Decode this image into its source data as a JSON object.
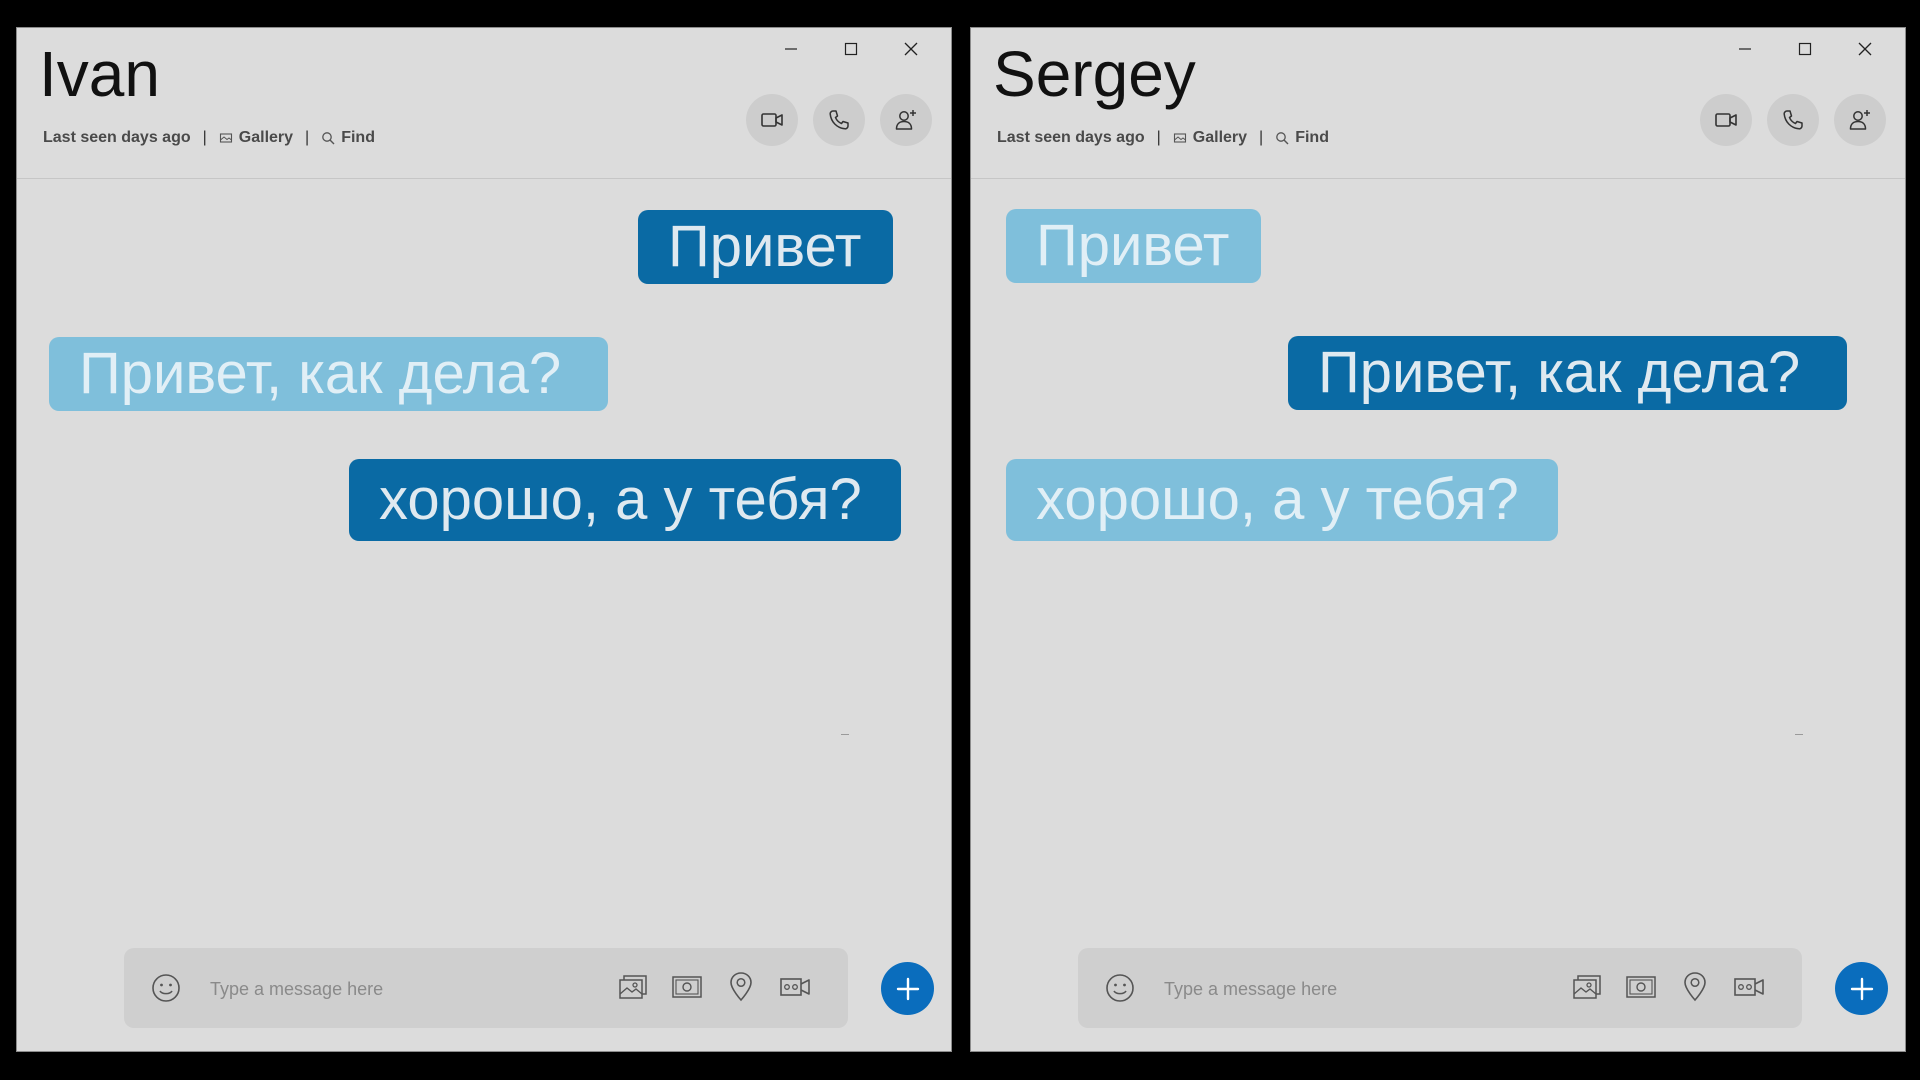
{
  "colors": {
    "sent_bubble": "#0a6aa4",
    "received_bubble": "#7fbfdb",
    "window_bg": "#dcdcdc",
    "fab": "#0a6dbd"
  },
  "left": {
    "contact_name": "Ivan",
    "status": "Last seen days ago",
    "gallery_label": "Gallery",
    "find_label": "Find",
    "composer_placeholder": "Type a message here",
    "messages": [
      {
        "text": "Привет",
        "direction": "sent"
      },
      {
        "text": "Привет, как дела?",
        "direction": "received"
      },
      {
        "text": "хорошо, а у тебя?",
        "direction": "sent"
      }
    ]
  },
  "right": {
    "contact_name": "Sergey",
    "status": "Last seen days ago",
    "gallery_label": "Gallery",
    "find_label": "Find",
    "composer_placeholder": "Type a message here",
    "messages": [
      {
        "text": "Привет",
        "direction": "received"
      },
      {
        "text": "Привет, как дела?",
        "direction": "sent"
      },
      {
        "text": "хорошо, а у тебя?",
        "direction": "received"
      }
    ]
  },
  "icons": {
    "window_controls": [
      "minimize-icon",
      "maximize-icon",
      "close-icon"
    ],
    "header_actions": [
      "video-call-icon",
      "audio-call-icon",
      "add-contact-icon"
    ],
    "composer_tools": [
      "emoji-icon",
      "image-icon",
      "money-icon",
      "location-icon",
      "video-message-icon"
    ],
    "send_button": "plus-icon"
  }
}
